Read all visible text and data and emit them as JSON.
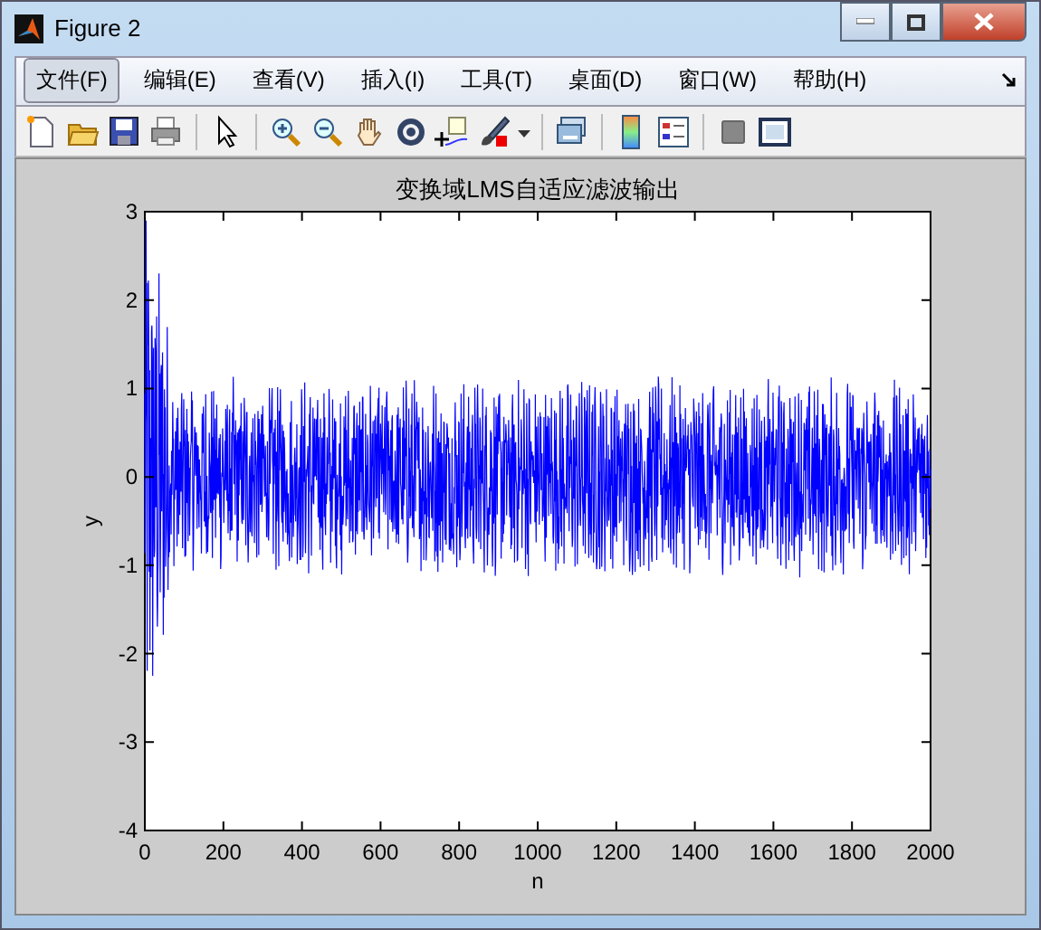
{
  "window": {
    "title": "Figure 2"
  },
  "menu": [
    {
      "label": "文件(F)",
      "selected": true
    },
    {
      "label": "编辑(E)",
      "selected": false
    },
    {
      "label": "查看(V)",
      "selected": false
    },
    {
      "label": "插入(I)",
      "selected": false
    },
    {
      "label": "工具(T)",
      "selected": false
    },
    {
      "label": "桌面(D)",
      "selected": false
    },
    {
      "label": "窗口(W)",
      "selected": false
    },
    {
      "label": "帮助(H)",
      "selected": false
    }
  ],
  "plot": {
    "title": "变换域LMS自适应滤波输出",
    "xlabel": "n",
    "ylabel": "y",
    "x_tick_labels": [
      "0",
      "200",
      "400",
      "600",
      "800",
      "1000",
      "1200",
      "1400",
      "1600",
      "1800",
      "2000"
    ],
    "y_tick_labels": [
      "3",
      "2",
      "1",
      "0",
      "-1",
      "-2",
      "-3",
      "-4"
    ]
  }
}
